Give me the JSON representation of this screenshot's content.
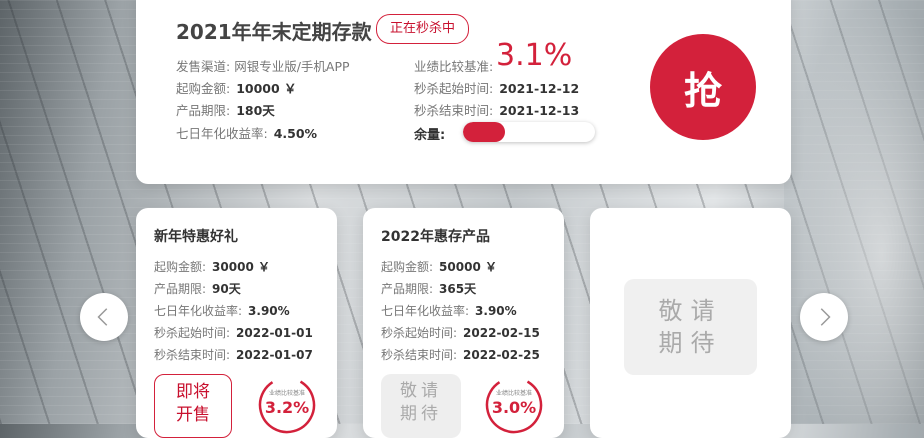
{
  "featured": {
    "title": "2021年年末定期存款",
    "badge": "正在秒杀中",
    "channel_label": "发售渠道:",
    "channel_value": "网银专业版/手机APP",
    "min_amount_label": "起购金额:",
    "min_amount_value": "10000 ￥",
    "term_label": "产品期限:",
    "term_value": "180天",
    "yield7_label": "七日年化收益率:",
    "yield7_value": "4.50%",
    "benchmark_label": "业绩比较基准:",
    "benchmark_value": "3.1%",
    "start_label": "秒杀起始时间:",
    "start_value": "2021-12-12",
    "end_label": "秒杀结束时间:",
    "end_value": "2021-12-13",
    "remaining_label": "余量:",
    "remaining_fraction": 0.32,
    "grab_label": "抢"
  },
  "products": [
    {
      "title": "新年特惠好礼",
      "min_amount_label": "起购金额:",
      "min_amount_value": "30000 ￥",
      "term_label": "产品期限:",
      "term_value": "90天",
      "yield7_label": "七日年化收益率:",
      "yield7_value": "3.90%",
      "start_label": "秒杀起始时间:",
      "start_value": "2022-01-01",
      "end_label": "秒杀结束时间:",
      "end_value": "2022-01-07",
      "button_line1": "即将",
      "button_line2": "开售",
      "ring_label": "业绩比较基准",
      "ring_value": "3.2%"
    },
    {
      "title": "2022年惠存产品",
      "min_amount_label": "起购金额:",
      "min_amount_value": "50000 ￥",
      "term_label": "产品期限:",
      "term_value": "365天",
      "yield7_label": "七日年化收益率:",
      "yield7_value": "3.90%",
      "start_label": "秒杀起始时间:",
      "start_value": "2022-02-15",
      "end_label": "秒杀结束时间:",
      "end_value": "2022-02-25",
      "button_line1": "敬请",
      "button_line2": "期待",
      "ring_label": "业绩比较基准",
      "ring_value": "3.0%"
    }
  ],
  "placeholder": {
    "line1": "敬请",
    "line2": "期待"
  },
  "icons": {
    "prev": "chevron-left-icon",
    "next": "chevron-right-icon"
  },
  "colors": {
    "accent": "#d3213b",
    "muted_button": "#eeeeee"
  }
}
